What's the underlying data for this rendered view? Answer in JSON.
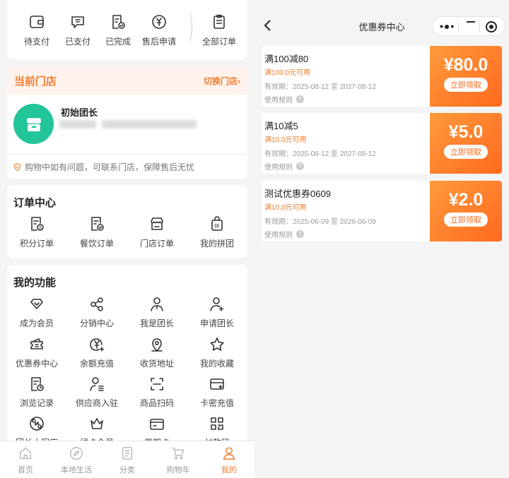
{
  "left": {
    "order_status": [
      {
        "label": "待支付",
        "icon": "wallet-icon"
      },
      {
        "label": "已支付",
        "icon": "paid-chat-icon"
      },
      {
        "label": "已完成",
        "icon": "completed-doc-icon"
      },
      {
        "label": "售后申请",
        "icon": "yuan-coin-icon"
      },
      {
        "label": "全部订单",
        "icon": "clipboard-icon"
      }
    ],
    "store": {
      "title": "当前门店",
      "switch_label": "切换门店",
      "switch_arrow": "›",
      "name": "初始团长",
      "notice": "购物中如有问题，可联系门店，保障售后无忧"
    },
    "order_center": {
      "title": "订单中心",
      "items": [
        {
          "label": "积分订单",
          "icon": "points-order-icon"
        },
        {
          "label": "餐饮订单",
          "icon": "food-order-icon"
        },
        {
          "label": "门店订单",
          "icon": "store-order-icon"
        },
        {
          "label": "我的拼团",
          "icon": "group-buy-icon"
        }
      ]
    },
    "functions": {
      "title": "我的功能",
      "items": [
        {
          "label": "成为会员",
          "icon": "diamond-icon"
        },
        {
          "label": "分销中心",
          "icon": "share-icon"
        },
        {
          "label": "我是团长",
          "icon": "leader-icon"
        },
        {
          "label": "申请团长",
          "icon": "apply-leader-icon"
        },
        {
          "label": "优惠券中心",
          "icon": "coupon-icon"
        },
        {
          "label": "余额充值",
          "icon": "recharge-icon"
        },
        {
          "label": "收货地址",
          "icon": "location-icon"
        },
        {
          "label": "我的收藏",
          "icon": "star-icon"
        },
        {
          "label": "浏览记录",
          "icon": "history-icon"
        },
        {
          "label": "供应商入驻",
          "icon": "supplier-icon"
        },
        {
          "label": "商品扫码",
          "icon": "scan-icon"
        },
        {
          "label": "卡密充值",
          "icon": "card-icon"
        },
        {
          "label": "团长小程序",
          "icon": "miniapp-icon"
        },
        {
          "label": "绿卡会员",
          "icon": "crown-icon"
        },
        {
          "label": "周期卡",
          "icon": "period-card-icon"
        },
        {
          "label": "付款码",
          "icon": "paycode-icon"
        }
      ]
    },
    "tabbar": [
      {
        "label": "首页",
        "icon": "home-icon",
        "active": false
      },
      {
        "label": "本地生活",
        "icon": "compass-icon",
        "active": false
      },
      {
        "label": "分类",
        "icon": "category-icon",
        "active": false
      },
      {
        "label": "购物车",
        "icon": "cart-icon",
        "active": false
      },
      {
        "label": "我的",
        "icon": "user-icon",
        "active": true
      }
    ]
  },
  "right": {
    "title": "优惠券中心",
    "capsule": {
      "more": "•●•"
    },
    "coupons": [
      {
        "name": "满100减80",
        "condition": "满100.0元可用",
        "validity": "有效期：2025-08-12 至 2027-08-12",
        "rule": "使用规则",
        "amount": "¥80.0",
        "button": "立即领取"
      },
      {
        "name": "满10减5",
        "condition": "满10.0元可用",
        "validity": "有效期：2025-08-12 至 2027-08-12",
        "rule": "使用规则",
        "amount": "¥5.0",
        "button": "立即领取"
      },
      {
        "name": "测试优惠券0609",
        "condition": "满10.0元可用",
        "validity": "有效期：2025-06-09 至 2026-06-09",
        "rule": "使用规则",
        "amount": "¥2.0",
        "button": "立即领取"
      }
    ]
  },
  "colors": {
    "accent": "#f07c2d",
    "coupon_gradient_start": "#ff9a3c",
    "coupon_gradient_end": "#ff6a1f",
    "avatar": "#23c59a"
  }
}
